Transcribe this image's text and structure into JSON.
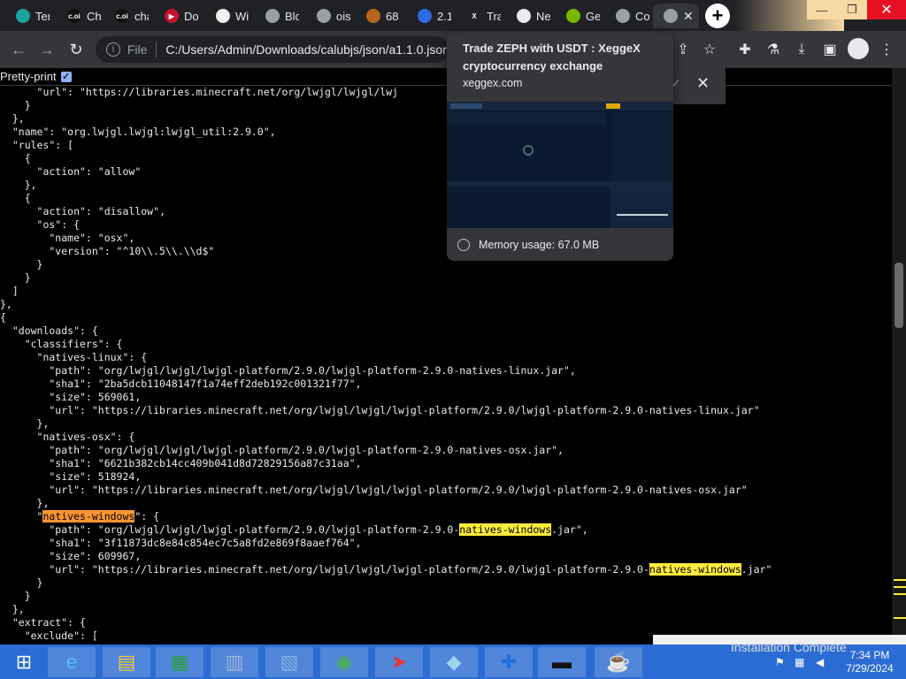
{
  "tabs": [
    {
      "label": "Ter",
      "favicon": "teal-circle",
      "color": "#1aa39a",
      "text": ""
    },
    {
      "label": "Ch",
      "favicon": "coin-market-icon",
      "color": "#111111",
      "text": "c.oi"
    },
    {
      "label": "cha",
      "favicon": "coin-market-icon",
      "color": "#111111",
      "text": "c.oi"
    },
    {
      "label": "Do",
      "favicon": "arrow-icon",
      "color": "#c8102e",
      "text": "▶"
    },
    {
      "label": "Wi",
      "favicon": "wikipedia-icon",
      "color": "#eeeeee",
      "text": "W"
    },
    {
      "label": "Blo",
      "favicon": "globe-icon",
      "color": "#9aa0a6",
      "text": ""
    },
    {
      "label": "ois",
      "favicon": "globe-icon",
      "color": "#9aa0a6",
      "text": ""
    },
    {
      "label": "68",
      "favicon": "lion-icon",
      "color": "#b5651d",
      "text": ""
    },
    {
      "label": "2.1",
      "favicon": "cloud-icon",
      "color": "#2d6ae3",
      "text": ""
    },
    {
      "label": "Tra",
      "favicon": "xeggex-icon",
      "color": "#202124",
      "text": "X"
    },
    {
      "label": "Ne",
      "favicon": "chrome-icon",
      "color": "#e8eaed",
      "text": ""
    },
    {
      "label": "Ge",
      "favicon": "nvidia-icon",
      "color": "#76b900",
      "text": ""
    },
    {
      "label": "Co",
      "favicon": "globe-icon",
      "color": "#9aa0a6",
      "text": ""
    },
    {
      "label": "",
      "favicon": "globe-icon",
      "color": "#9aa0a6",
      "text": "",
      "active": true,
      "close": "✕"
    }
  ],
  "new_tab": "+",
  "window_controls": {
    "minimize": "—",
    "restore": "❐",
    "close": "✕"
  },
  "toolbar": {
    "back": "←",
    "forward": "→",
    "reload": "↻",
    "url_chip": "File",
    "url": "C:/Users/Admin/Downloads/calubjs/json/a1.1.0.json",
    "share": "⇪",
    "star": "☆",
    "extensions": "✚",
    "labs": "⚗",
    "download": "⤓",
    "sidebar": "▣",
    "menu": "⋮"
  },
  "pretty_print": {
    "label": "Pretty-print",
    "checked": "✓"
  },
  "hover_card": {
    "title": "Trade ZEPH with USDT : XeggeX cryptocurrency exchange",
    "domain": "xeggex.com",
    "memory": "Memory usage: 67.0 MB"
  },
  "download_bubble": {
    "check": "✓",
    "close": "✕"
  },
  "json_text": "      \"url\": \"https://libraries.minecraft.net/org/lwjgl/lwjgl/lwj\n    }\n  },\n  \"name\": \"org.lwjgl.lwjgl:lwjgl_util:2.9.0\",\n  \"rules\": [\n    {\n      \"action\": \"allow\"\n    },\n    {\n      \"action\": \"disallow\",\n      \"os\": {\n        \"name\": \"osx\",\n        \"version\": \"^10\\\\.5\\\\.\\\\d$\"\n      }\n    }\n  ]\n},\n{\n  \"downloads\": {\n    \"classifiers\": {\n      \"natives-linux\": {\n        \"path\": \"org/lwjgl/lwjgl/lwjgl-platform/2.9.0/lwjgl-platform-2.9.0-natives-linux.jar\",\n        \"sha1\": \"2ba5dcb11048147f1a74eff2deb192c001321f77\",\n        \"size\": 569061,\n        \"url\": \"https://libraries.minecraft.net/org/lwjgl/lwjgl/lwjgl-platform/2.9.0/lwjgl-platform-2.9.0-natives-linux.jar\"\n      },\n      \"natives-osx\": {\n        \"path\": \"org/lwjgl/lwjgl/lwjgl-platform/2.9.0/lwjgl-platform-2.9.0-natives-osx.jar\",\n        \"sha1\": \"6621b382cb14cc409b041d8d72829156a87c31aa\",\n        \"size\": 518924,\n        \"url\": \"https://libraries.minecraft.net/org/lwjgl/lwjgl/lwjgl-platform/2.9.0/lwjgl-platform-2.9.0-natives-osx.jar\"\n      },\n      \"natives-windows\": {\n        \"path\": \"org/lwjgl/lwjgl/lwjgl-platform/2.9.0/lwjgl-platform-2.9.0-natives-windows.jar\",\n        \"sha1\": \"3f11873dc8e84c854ec7c5a8fd2e869f8aaef764\",\n        \"size\": 609967,\n        \"url\": \"https://libraries.minecraft.net/org/lwjgl/lwjgl/lwjgl-platform/2.9.0/lwjgl-platform-2.9.0-natives-windows.jar\"\n      }\n    }\n  },\n  \"extract\": {\n    \"exclude\": [",
  "search_term": "natives-windows",
  "taskbar": {
    "items": [
      "start-button",
      "internet-explorer",
      "file-explorer",
      "store",
      "task-manager",
      "control-panel",
      "chrome",
      "app-red-arrow",
      "app-blue",
      "defender",
      "command-prompt",
      "java"
    ],
    "toast": "Installation Complete",
    "time": "7:34 PM",
    "date": "7/29/2024"
  }
}
